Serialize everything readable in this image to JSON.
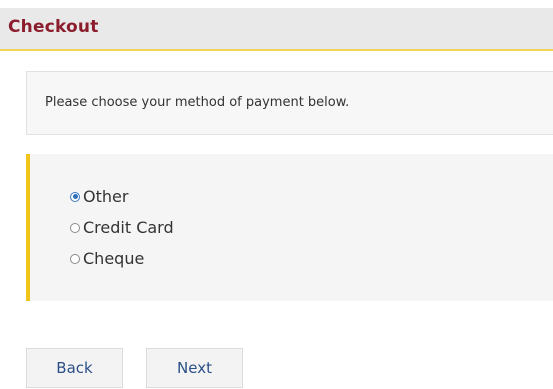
{
  "header": {
    "title": "Checkout"
  },
  "info": {
    "text": "Please choose your method of payment below."
  },
  "payment_methods": {
    "selected": "Other",
    "options": [
      {
        "label": "Other",
        "checked": true
      },
      {
        "label": "Credit Card",
        "checked": false
      },
      {
        "label": "Cheque",
        "checked": false
      }
    ]
  },
  "buttons": {
    "back_label": "Back",
    "next_label": "Next"
  },
  "colors": {
    "title": "#8b1d2c",
    "accent_yellow": "#f0c419",
    "button_text": "#2b4f86",
    "radio_selected": "#2f6fc0"
  }
}
